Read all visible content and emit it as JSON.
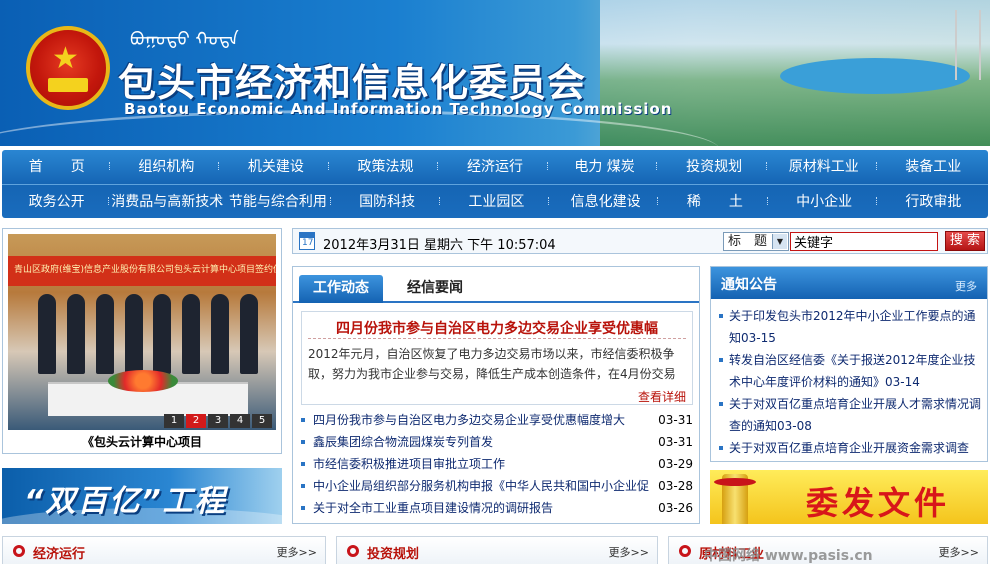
{
  "banner": {
    "title_cn": "包头市经济和信息化委员会",
    "title_en": "Baotou Economic And Information Technology Commission",
    "mongol_script": "ᠪᠤᠭᠤᠲᠤ ᠬᠣᠲᠠ"
  },
  "nav": {
    "row1": [
      "首　　页",
      "组织机构",
      "机关建设",
      "政策法规",
      "经济运行",
      "电力 煤炭",
      "投资规划",
      "原材料工业",
      "装备工业"
    ],
    "row2": [
      "政务公开",
      "消费品与高新技术",
      "节能与综合利用",
      "国防科技",
      "工业园区",
      "信息化建设",
      "稀　　土",
      "中小企业",
      "行政审批"
    ]
  },
  "slideshow": {
    "backdrop_text": "青山区政府(维宝)信息产业股份有限公司包头云计算中心项目签约仪式",
    "caption": "《包头云计算中心项目",
    "pages": [
      "1",
      "2",
      "3",
      "4",
      "5"
    ],
    "active_page": 2
  },
  "left_banner": {
    "text": "“双百亿”工程"
  },
  "datebar": {
    "cal_day": "17",
    "date_text": "2012年3月31日 星期六 下午 10:57:04",
    "search_type": "标　题",
    "search_value": "关键字",
    "search_button": "搜 索"
  },
  "news": {
    "tab_active": "工作动态",
    "tab_inactive": "经信要闻",
    "headline_title": "四月份我市参与自治区电力多边交易企业享受优惠幅",
    "headline_body": "2012年元月，自治区恢复了电力多边交易市场以来，市经信委积极争取，努力为我市企业参与交易，降低生产成本创造条件，在4月份交易",
    "headline_more": "查看详细",
    "items": [
      {
        "title": "四月份我市参与自治区电力多边交易企业享受优惠幅度增大",
        "date": "03-31"
      },
      {
        "title": "鑫辰集团综合物流园煤炭专列首发",
        "date": "03-31"
      },
      {
        "title": "市经信委积极推进项目审批立项工作",
        "date": "03-29"
      },
      {
        "title": "中小企业局组织部分服务机构申报《中华人民共和国中小企业促",
        "date": "03-28"
      },
      {
        "title": "关于对全市工业重点项目建设情况的调研报告",
        "date": "03-26"
      }
    ]
  },
  "notice": {
    "title": "通知公告",
    "more": "更多",
    "items": [
      "关于印发包头市2012年中小企业工作要点的通知03-15",
      "转发自治区经信委《关于报送2012年度企业技术中心年度评价材料的通知》03-14",
      "关于对双百亿重点培育企业开展人才需求情况调查的通知03-08",
      "关于对双百亿重点培育企业开展资金需求调查"
    ]
  },
  "weifa_banner": {
    "text": "委发文件"
  },
  "sections": [
    {
      "title": "经济运行",
      "more": "更多>>"
    },
    {
      "title": "投资规划",
      "more": "更多>>"
    },
    {
      "title": "原材料工业",
      "more": "更多>>"
    }
  ],
  "watermark": "中国网络 www.pasis.cn"
}
